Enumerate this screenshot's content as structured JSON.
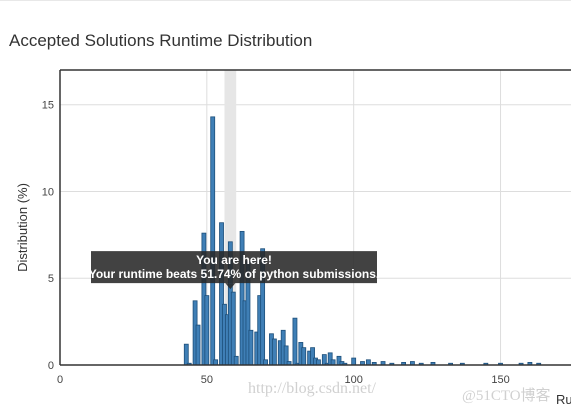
{
  "chart_data": {
    "type": "bar",
    "title": "Accepted Solutions Runtime Distribution",
    "xlabel": "Ru",
    "ylabel": "Distribution (%)",
    "xlim": [
      0,
      174
    ],
    "ylim": [
      0,
      17
    ],
    "x_ticks": [
      0,
      50,
      100,
      150
    ],
    "y_ticks": [
      0,
      5,
      10,
      15
    ],
    "grid": true,
    "bar_color": "#3f7fb6",
    "bar_edge_color": "#1d4f7a",
    "highlight_band": [
      56,
      60
    ],
    "series": [
      {
        "x": [
          43,
          44,
          46,
          47,
          49,
          50,
          52,
          53,
          55,
          56,
          57,
          58,
          59,
          60,
          62,
          63,
          64,
          65,
          67,
          68,
          69,
          70,
          72,
          73,
          75,
          76,
          77,
          78,
          80,
          81,
          82,
          83,
          85,
          86,
          87,
          88,
          90,
          91,
          92,
          93,
          95,
          96,
          97,
          100,
          103,
          105,
          107,
          110,
          113,
          117,
          120,
          123,
          127,
          133,
          137,
          145,
          150,
          157,
          160,
          163
        ],
        "values": [
          1.2,
          0.1,
          3.7,
          2.3,
          7.6,
          4.0,
          14.3,
          0.3,
          8.2,
          3.5,
          2.9,
          7.1,
          4.2,
          0.5,
          7.7,
          3.7,
          6.0,
          2.0,
          1.9,
          4.0,
          6.7,
          0.3,
          1.8,
          1.5,
          1.4,
          2.0,
          1.1,
          0.2,
          2.7,
          0.1,
          1.3,
          1.0,
          0.8,
          1.0,
          0.4,
          0.3,
          0.6,
          0.1,
          0.7,
          0.3,
          0.5,
          0.2,
          0.1,
          0.4,
          0.2,
          0.3,
          0.15,
          0.2,
          0.1,
          0.15,
          0.2,
          0.1,
          0.15,
          0.1,
          0.1,
          0.1,
          0.1,
          0.1,
          0.15,
          0.1
        ]
      }
    ],
    "annotation": {
      "line1": "You are here!",
      "line2": "Your runtime beats 51.74% of python submissions.",
      "anchor_x": 58,
      "anchor_y": 4.2
    }
  },
  "watermark": {
    "url": "http://blog.csdn.net/",
    "mark": "@51CTO博客"
  }
}
